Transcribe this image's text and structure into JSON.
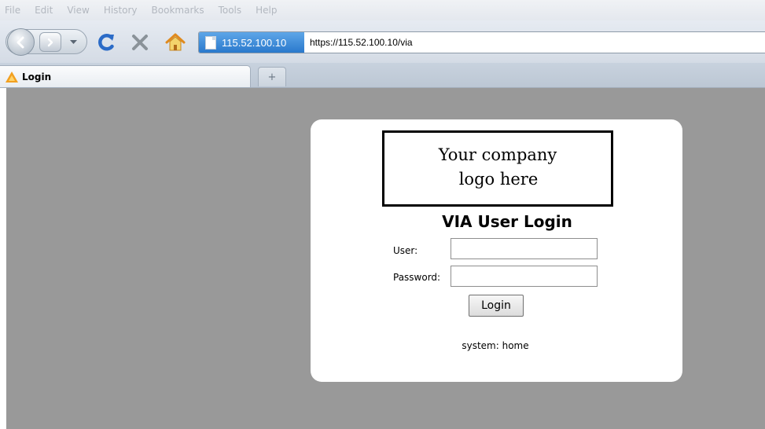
{
  "menu": {
    "items": [
      {
        "label": "File"
      },
      {
        "label": "Edit"
      },
      {
        "label": "View"
      },
      {
        "label": "History"
      },
      {
        "label": "Bookmarks"
      },
      {
        "label": "Tools"
      },
      {
        "label": "Help"
      }
    ]
  },
  "toolbar": {
    "back_icon": "back-arrow-icon",
    "forward_icon": "forward-arrow-icon",
    "reload_icon": "reload-icon",
    "stop_icon": "stop-icon",
    "home_icon": "home-icon"
  },
  "address": {
    "identity_label": "115.52.100.10",
    "url": "https://115.52.100.10/via"
  },
  "tabs": [
    {
      "label": "Login",
      "icon": "site-favicon"
    }
  ],
  "new_tab_symbol": "+",
  "login": {
    "logo_line1": "Your company",
    "logo_line2": "logo here",
    "title": "VIA User Login",
    "user_label": "User:",
    "user_value": "",
    "password_label": "Password:",
    "password_value": "",
    "button_label": "Login",
    "system_line": "system: home"
  },
  "colors": {
    "content_background": "#999999",
    "identity_blue": "#2a79cc",
    "reload_blue": "#2b6bc7",
    "stop_gray": "#8a9299"
  }
}
